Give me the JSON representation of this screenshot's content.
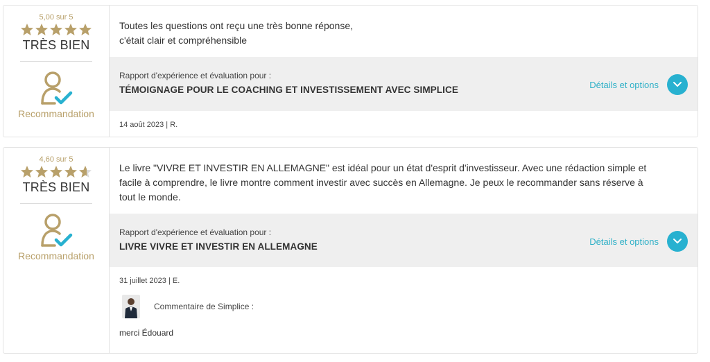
{
  "reviews": [
    {
      "score": "5,00 sur 5",
      "stars": [
        1,
        1,
        1,
        1,
        1
      ],
      "rating_word": "TRÈS BIEN",
      "recommendation": "Recommandation",
      "text": "Toutes les questions ont reçu une très bonne réponse, c'était clair et compréhensible",
      "text_lines": [
        "Toutes les questions ont reçu une très bonne réponse,",
        "c'était clair et compréhensible"
      ],
      "report_label": "Rapport d'expérience et évaluation pour :",
      "report_title": "TÉMOIGNAGE POUR LE COACHING ET INVESTISSEMENT AVEC SIMPLICE",
      "details_label": "Détails et options",
      "meta": "14 août 2023 | R."
    },
    {
      "score": "4,60 sur 5",
      "stars": [
        1,
        1,
        1,
        1,
        0.6
      ],
      "rating_word": "TRÈS BIEN",
      "recommendation": "Recommandation",
      "text_lines": [
        "Le livre \"VIVRE ET INVESTIR EN ALLEMAGNE\" est idéal pour un état d'esprit d'investisseur. Avec une rédaction simple et",
        "facile à comprendre, le livre montre comment investir avec succès en Allemagne. Je peux le recommander sans réserve à",
        "tout le monde."
      ],
      "report_label": "Rapport d'expérience et évaluation pour :",
      "report_title": "LIVRE VIVRE ET INVESTIR EN ALLEMAGNE",
      "details_label": "Détails et options",
      "meta": "31 juillet 2023 | E.",
      "reply_label": "Commentaire de Simplice :",
      "reply_text": "merci Édouard"
    }
  ],
  "colors": {
    "gold": "#b8a06a",
    "accent": "#28b1d0",
    "link": "#2fb0c7",
    "report_bg": "#efefef"
  },
  "icons": {
    "star": "star-icon",
    "recommendation": "person-check-icon",
    "details": "chevron-down-icon",
    "avatar": "avatar"
  }
}
